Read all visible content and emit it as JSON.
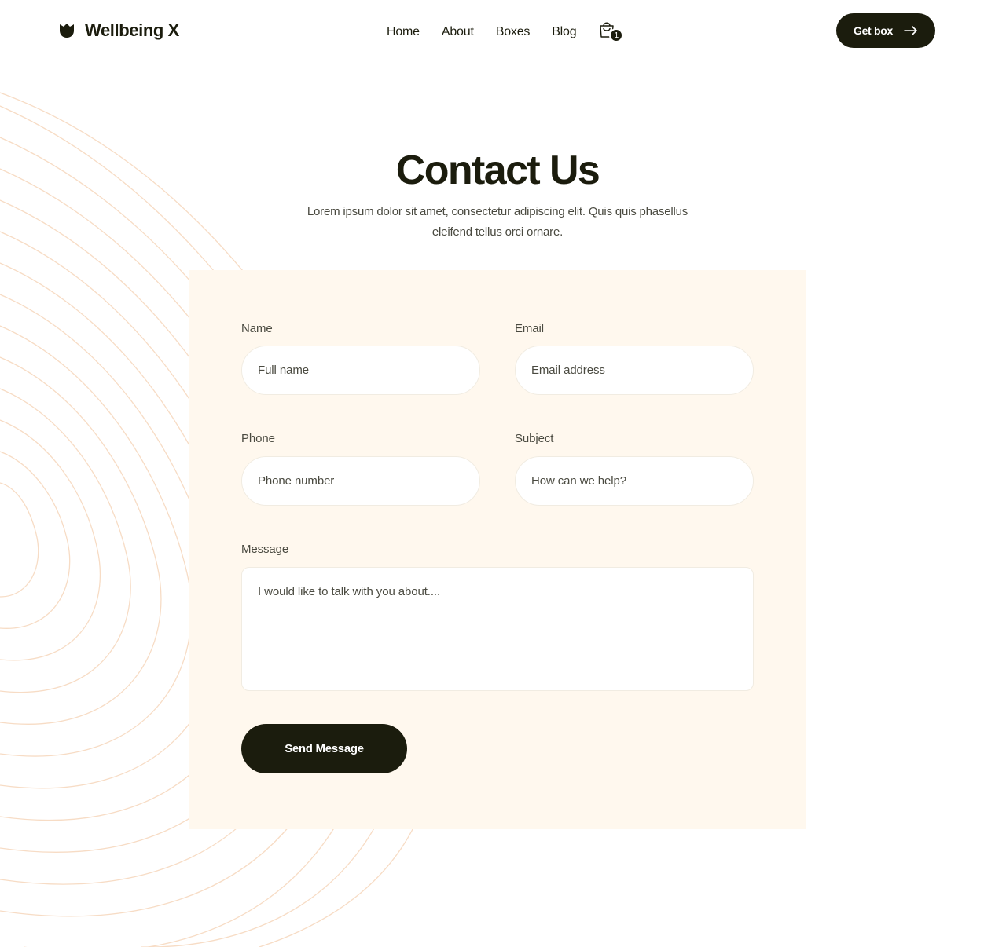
{
  "brand": {
    "name": "Wellbeing X",
    "logo_icon": "tulip-icon"
  },
  "nav": {
    "items": [
      {
        "label": "Home"
      },
      {
        "label": "About"
      },
      {
        "label": "Boxes"
      },
      {
        "label": "Blog"
      }
    ],
    "cart": {
      "icon": "shopping-bag-icon",
      "count": "1"
    },
    "cta": {
      "label": "Get box",
      "icon": "arrow-right-icon"
    }
  },
  "hero": {
    "title": "Contact Us",
    "subtitle": "Lorem ipsum dolor sit amet, consectetur adipiscing elit. Quis quis phasellus eleifend tellus orci ornare."
  },
  "form": {
    "name": {
      "label": "Name",
      "placeholder": "Full name"
    },
    "email": {
      "label": "Email",
      "placeholder": "Email address"
    },
    "phone": {
      "label": "Phone",
      "placeholder": "Phone number"
    },
    "subject": {
      "label": "Subject",
      "placeholder": "How can we help?"
    },
    "message": {
      "label": "Message",
      "placeholder": "I would like to talk with you about...."
    },
    "submit_label": "Send Message"
  },
  "colors": {
    "primary": "#1b1c0d",
    "card_background": "#fff8ee",
    "decorative_lines": "#f7dcc5"
  }
}
